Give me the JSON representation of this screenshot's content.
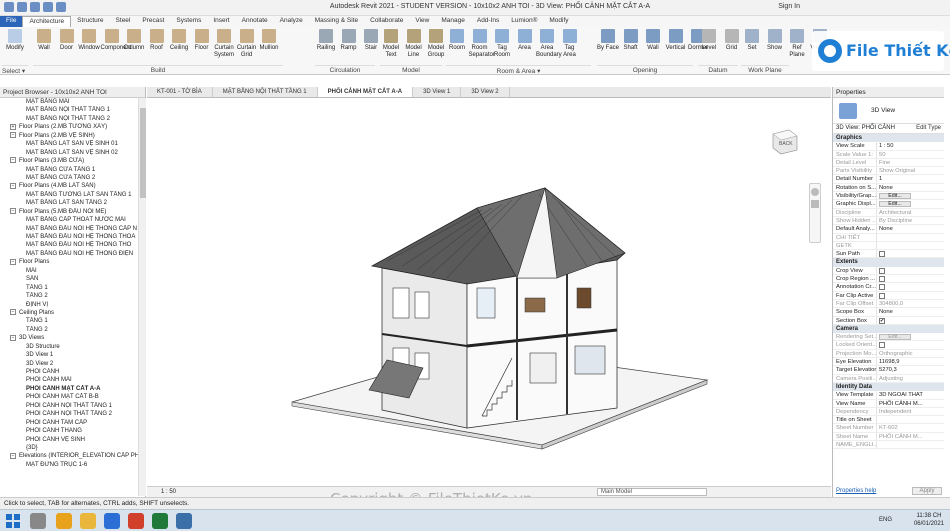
{
  "window": {
    "title": "Autodesk Revit 2021 - STUDENT VERSION - 10x10x2 ANH TOI - 3D View: PHỐI CẢNH MẶT CẮT A-A",
    "sign_in": "Sign In"
  },
  "ribbon_tabs": [
    "File",
    "Architecture",
    "Structure",
    "Steel",
    "Precast",
    "Systems",
    "Insert",
    "Annotate",
    "Analyze",
    "Massing & Site",
    "Collaborate",
    "View",
    "Manage",
    "Add-Ins",
    "Lumion®",
    "Modify"
  ],
  "ribbon": {
    "modify": "Modify",
    "select": "Select ▾",
    "build": [
      "Wall",
      "Door",
      "Window",
      "Component",
      "Column",
      "Roof",
      "Ceiling",
      "Floor",
      "Curtain System",
      "Curtain Grid",
      "Mullion"
    ],
    "circulation": [
      "Railing",
      "Ramp",
      "Stair"
    ],
    "model": [
      "Model Text",
      "Model Line",
      "Model Group"
    ],
    "room": [
      "Room",
      "Room Separator",
      "Tag Room",
      "Area",
      "Area Boundary",
      "Tag Area"
    ],
    "opening": [
      "By Face",
      "Shaft",
      "Wall",
      "Vertical",
      "Dormer"
    ],
    "datum": [
      "Level",
      "Grid"
    ],
    "workplane": [
      "Set",
      "Show",
      "Ref Plane",
      "Viewer"
    ],
    "panels": [
      "Build",
      "Circulation",
      "Model",
      "Room & Area ▾",
      "Opening",
      "Datum",
      "Work Plane"
    ]
  },
  "logo": {
    "text": "File Thiết Kế.vn"
  },
  "project_browser": {
    "title": "Project Browser - 10x10x2 ANH TOI",
    "items": [
      {
        "t": "MẶT BẰNG MÁI",
        "d": 3
      },
      {
        "t": "MẶT BẰNG NỘI THẤT TẦNG 1",
        "d": 3
      },
      {
        "t": "MẶT BẰNG NỘI THẤT TẦNG 2",
        "d": 3
      },
      {
        "t": "Floor Plans (2.MB TƯỜNG XÂY)",
        "d": 1,
        "tg": "+"
      },
      {
        "t": "Floor Plans (2.MB VỆ SINH)",
        "d": 1,
        "tg": "−"
      },
      {
        "t": "MẶT BẰNG LÁT SÀN VỆ SINH 01",
        "d": 3
      },
      {
        "t": "MẶT BẰNG LÁT SÀN VỆ SINH 02",
        "d": 3
      },
      {
        "t": "Floor Plans (3.MB CỬA)",
        "d": 1,
        "tg": "−"
      },
      {
        "t": "MẶT BẰNG CỬA TẦNG 1",
        "d": 3
      },
      {
        "t": "MẶT BẰNG CỬA TẦNG 2",
        "d": 3
      },
      {
        "t": "Floor Plans (4.MB LÁT SÀN)",
        "d": 1,
        "tg": "−"
      },
      {
        "t": "MẶT BẰNG TƯỜNG LÁT SÀN TẦNG 1",
        "d": 3
      },
      {
        "t": "MẶT BẰNG LÁT SÀN TẦNG 2",
        "d": 3
      },
      {
        "t": "Floor Plans (5.MB ĐẤU NỐI ME)",
        "d": 1,
        "tg": "−"
      },
      {
        "t": "MẶT BẰNG CẤP THOÁT NƯỚC MÁI",
        "d": 3
      },
      {
        "t": "MẶT BẰNG ĐẤU NỐI HỆ THỐNG CẤP N",
        "d": 3
      },
      {
        "t": "MẶT BẰNG ĐẤU NỐI HỆ THỐNG THOÁ",
        "d": 3
      },
      {
        "t": "MẶT BẰNG ĐẤU NỐI HỆ THỐNG THO",
        "d": 3
      },
      {
        "t": "MẶT BẰNG ĐẤU NỐI HỆ THỐNG ĐIỆN",
        "d": 3
      },
      {
        "t": "Floor Plans",
        "d": 1,
        "tg": "−"
      },
      {
        "t": "MÁI",
        "d": 3
      },
      {
        "t": "SÂN",
        "d": 3
      },
      {
        "t": "TẦNG 1",
        "d": 3
      },
      {
        "t": "TẦNG 2",
        "d": 3
      },
      {
        "t": "ĐỊNH VỊ",
        "d": 3
      },
      {
        "t": "Ceiling Plans",
        "d": 1,
        "tg": "−"
      },
      {
        "t": "TẦNG 1",
        "d": 3
      },
      {
        "t": "TẦNG 2",
        "d": 3
      },
      {
        "t": "3D Views",
        "d": 1,
        "tg": "−"
      },
      {
        "t": "3D Structure",
        "d": 3
      },
      {
        "t": "3D View 1",
        "d": 3
      },
      {
        "t": "3D View 2",
        "d": 3
      },
      {
        "t": "PHỐI CẢNH",
        "d": 3
      },
      {
        "t": "PHỐI CẢNH MÁI",
        "d": 3
      },
      {
        "t": "PHỐI CẢNH MẶT CẮT A-A",
        "d": 3,
        "sel": true
      },
      {
        "t": "PHỐI CẢNH MẶT CẮT B-B",
        "d": 3
      },
      {
        "t": "PHỐI CẢNH NỘI THẤT TẦNG 1",
        "d": 3
      },
      {
        "t": "PHỐI CẢNH NỘI THẤT TẦNG 2",
        "d": 3
      },
      {
        "t": "PHỐI CẢNH TAM CẤP",
        "d": 3
      },
      {
        "t": "PHỐI CẢNH THANG",
        "d": 3
      },
      {
        "t": "PHỐI CẢNH VỆ SINH",
        "d": 3
      },
      {
        "t": "{3D}",
        "d": 3
      },
      {
        "t": "Elevations (INTERIOR_ELEVATION CẤP PHÉP",
        "d": 1,
        "tg": "−"
      },
      {
        "t": "MẶT ĐỨNG TRỤC 1-6",
        "d": 3
      }
    ]
  },
  "view_tabs": [
    "KT-001 - TỜ BÌA",
    "MẶT BẰNG NỘI THẤT TẦNG 1",
    "PHỐI CẢNH MẶT CẮT A-A",
    "3D View 1",
    "3D View 2"
  ],
  "view_bar": {
    "scale": "1 : 50",
    "model": "Main Model"
  },
  "viewcube": {
    "face": "BACK"
  },
  "properties": {
    "title": "Properties",
    "type_name": "3D View",
    "selector": "3D View: PHỐI CẢNH",
    "edit_type": "Edit Type",
    "sections": [
      {
        "name": "Graphics",
        "rows": [
          {
            "k": "View Scale",
            "v": "1 : 50"
          },
          {
            "k": "Scale Value   1:",
            "v": "50",
            "dim": true
          },
          {
            "k": "Detail Level",
            "v": "Fine",
            "dim": true
          },
          {
            "k": "Parts Visibility",
            "v": "Show Original",
            "dim": true
          },
          {
            "k": "Detail Number",
            "v": "1"
          },
          {
            "k": "Rotation on S...",
            "v": "None"
          },
          {
            "k": "Visibility/Grap...",
            "btn": "Edit..."
          },
          {
            "k": "Graphic Displ...",
            "btn": "Edit..."
          },
          {
            "k": "Discipline",
            "v": "Architectural",
            "dim": true
          },
          {
            "k": "Show Hidden ...",
            "v": "By Discipline",
            "dim": true
          },
          {
            "k": "Default Analy...",
            "v": "None"
          },
          {
            "k": "CHI TIẾT",
            "v": "",
            "dim": true
          },
          {
            "k": "GETK",
            "v": "",
            "dim": true
          },
          {
            "k": "Sun Path",
            "cb": ""
          }
        ]
      },
      {
        "name": "Extents",
        "rows": [
          {
            "k": "Crop View",
            "cb": ""
          },
          {
            "k": "Crop Region ...",
            "cb": ""
          },
          {
            "k": "Annotation Cr...",
            "cb": ""
          },
          {
            "k": "Far Clip Active",
            "cb": ""
          },
          {
            "k": "Far Clip Offset",
            "v": "304800,0",
            "dim": true
          },
          {
            "k": "Scope Box",
            "v": "None"
          },
          {
            "k": "Section Box",
            "cb": "✔"
          }
        ]
      },
      {
        "name": "Camera",
        "rows": [
          {
            "k": "Rendering Set...",
            "btn": "Edit...",
            "dim": true
          },
          {
            "k": "Locked Orient...",
            "cb": "",
            "dim": true
          },
          {
            "k": "Projection Mo...",
            "v": "Orthographic",
            "dim": true
          },
          {
            "k": "Eye Elevation",
            "v": "11698,9"
          },
          {
            "k": "Target Elevation",
            "v": "5270,3"
          },
          {
            "k": "Camera Positi...",
            "v": "Adjusting",
            "dim": true
          }
        ]
      },
      {
        "name": "Identity Data",
        "rows": [
          {
            "k": "View Template",
            "v": "3D NGOAI THAT"
          },
          {
            "k": "View Name",
            "v": "PHỐI CẢNH M..."
          },
          {
            "k": "Dependency",
            "v": "Independent",
            "dim": true
          },
          {
            "k": "Title on Sheet",
            "v": ""
          },
          {
            "k": "Sheet Number",
            "v": "KT-602",
            "dim": true
          },
          {
            "k": "Sheet Name",
            "v": "PHỐI CẢNH M...",
            "dim": true
          },
          {
            "k": "NAME_ENGLI...",
            "v": "",
            "dim": true
          }
        ]
      }
    ],
    "help": "Properties help",
    "apply": "Apply"
  },
  "status": {
    "message": "Click to select, TAB for alternates, CTRL adds, SHIFT unselects."
  },
  "taskbar": {
    "lang": "ENG",
    "time": "11:38 CH",
    "date": "06/01/2021"
  },
  "watermark": "Copyright © FileThietKe.vn",
  "colors": {
    "file_tab": "#2d66b8",
    "accent": "#1f7fd4",
    "roof": "#555555"
  }
}
